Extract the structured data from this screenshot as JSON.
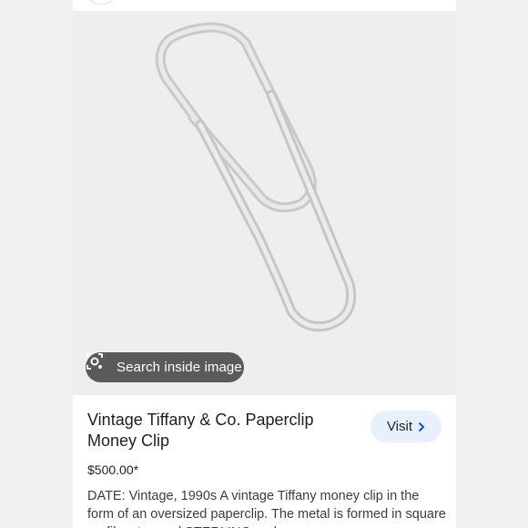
{
  "image": {
    "alt_icon": "paperclip-image",
    "search_chip_label": "Search inside image",
    "search_chip_icon": "lens-icon"
  },
  "product": {
    "title": "Vintage Tiffany & Co. Paperclip Money Clip",
    "price": "$500.00*",
    "description": "DATE: Vintage, 1990s A vintage Tiffany money clip in the form of an oversized paperclip. The metal is formed in square profile, stamped STERLING and"
  },
  "visit_button": {
    "label": "Visit",
    "icon": "chevron-right-icon"
  },
  "colors": {
    "accent": "#0b57d0",
    "button_bg": "#e8f0fe",
    "image_bg": "#eeedef"
  }
}
